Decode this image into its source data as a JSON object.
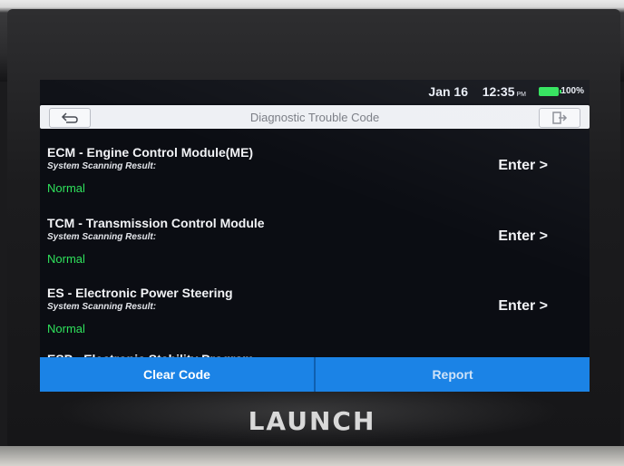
{
  "status_bar": {
    "date": "Jan 16",
    "time": "12:35",
    "ampm": "PM",
    "battery": "100%"
  },
  "header": {
    "title": "Diagnostic Trouble Code"
  },
  "modules": [
    {
      "name": "ECM - Engine Control Module(ME)",
      "subtitle": "System Scanning Result:",
      "status": "Normal",
      "action": "Enter >"
    },
    {
      "name": "TCM - Transmission Control Module",
      "subtitle": "System Scanning Result:",
      "status": "Normal",
      "action": "Enter >"
    },
    {
      "name": "ES - Electronic Power Steering",
      "subtitle": "System Scanning Result:",
      "status": "Normal",
      "action": "Enter >"
    },
    {
      "name": "ESP - Electronic Stability Program"
    }
  ],
  "footer": {
    "clear_label": "Clear Code",
    "report_label": "Report"
  },
  "device": {
    "brand": "LAUNCH"
  },
  "colors": {
    "accent": "#1b83e6",
    "status_normal": "#2fe25c",
    "battery": "#2ee35a"
  },
  "icons": {
    "back": "back-arrow-icon",
    "exit": "exit-icon",
    "battery": "battery-icon"
  }
}
